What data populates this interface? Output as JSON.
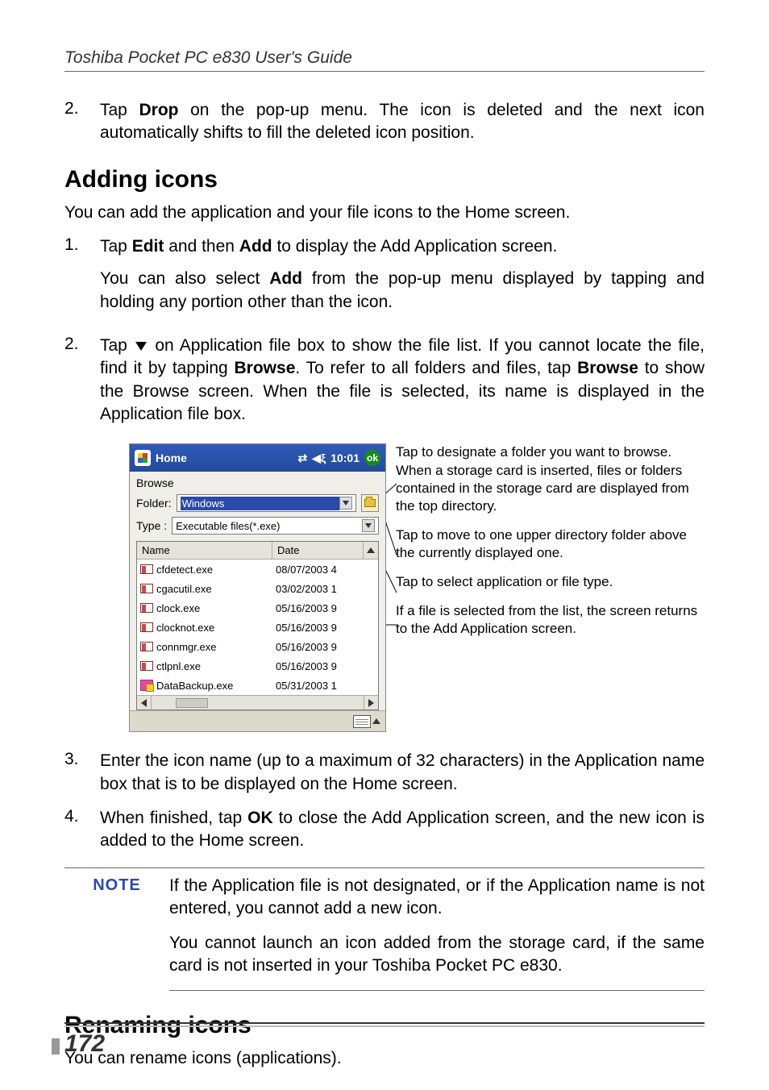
{
  "header": "Toshiba Pocket PC  e830 User's Guide",
  "step2_drop": "Tap Drop on the pop-up menu. The icon is deleted and the next icon automatically shifts to fill the deleted icon position.",
  "adding_icons_title": "Adding icons",
  "adding_intro": "You can add the application and your file icons to the Home screen.",
  "add_step1_a": "Tap Edit and then Add to display the Add Application screen.",
  "add_step1_b": "You can also select Add from the pop-up menu displayed by tapping and holding any portion other than the icon.",
  "add_step2": "Tap ▼ on Application file box to show the file list. If you cannot locate the file, find it by tapping Browse. To refer to all folders and files, tap Browse to show the Browse screen. When the file is selected, its name is displayed in the Application file box.",
  "add_step3": "Enter the icon name (up to a maximum of 32 characters) in the Application name box that is to be displayed on the Home screen.",
  "add_step4": "When finished, tap OK to close the Add Application screen, and the new icon is  added to the Home screen.",
  "note_label": "NOTE",
  "note1": "If the Application file is not designated, or if the Application name is not entered, you cannot add a new icon.",
  "note2": "You cannot launch an icon added from the storage card, if the same card is not inserted in your Toshiba Pocket PC e830.",
  "renaming_title": "Renaming icons",
  "renaming_intro": "You can rename icons (applications).",
  "page_number": "172",
  "screenshot": {
    "title": "Home",
    "time": "10:01",
    "ok": "ok",
    "browse_label": "Browse",
    "folder_label": "Folder:",
    "folder_value": "Windows",
    "type_label": "Type :",
    "type_value": "Executable files(*.exe)",
    "col_name": "Name",
    "col_date": "Date",
    "rows": [
      {
        "name": "cfdetect.exe",
        "date": "08/07/2003 4"
      },
      {
        "name": "cgacutil.exe",
        "date": "03/02/2003 1"
      },
      {
        "name": "clock.exe",
        "date": "05/16/2003 9"
      },
      {
        "name": "clocknot.exe",
        "date": "05/16/2003 9"
      },
      {
        "name": "connmgr.exe",
        "date": "05/16/2003 9"
      },
      {
        "name": "ctlpnl.exe",
        "date": "05/16/2003 9"
      },
      {
        "name": "DataBackup.exe",
        "date": "05/31/2003 1"
      }
    ]
  },
  "annotations": {
    "a1": "Tap to designate a folder you want to browse. When a storage card is inserted, files or folders contained in the storage card are displayed from the top directory.",
    "a2": "Tap to move to one upper directory folder above the currently displayed one.",
    "a3": "Tap to select application or file type.",
    "a4": "If a file is selected from the list, the screen returns to the Add Application screen."
  }
}
